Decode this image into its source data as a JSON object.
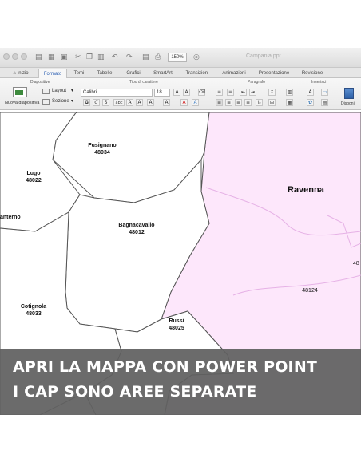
{
  "window": {
    "title": "Campania.ppt",
    "zoom": "150%"
  },
  "tabs": [
    "Inizio",
    "Formato",
    "Temi",
    "Tabelle",
    "Grafici",
    "SmartArt",
    "Transizioni",
    "Animazioni",
    "Presentazione",
    "Revisione"
  ],
  "active_tab": "Formato",
  "ribbon": {
    "groups": {
      "slides": "Diapositive",
      "font": "Tipo di carattere",
      "paragraph": "Paragrafo",
      "insert": "Inserisci"
    },
    "new_slide": "Nuova diapositiva",
    "layout": "Layout",
    "section": "Sezione",
    "font_name": "Calibri",
    "font_size": "18",
    "arrange": "Disponi"
  },
  "map": {
    "fill_colors": {
      "province_a": "#ffffff",
      "province_b": "#fde7fb"
    },
    "places": [
      {
        "name": "Fusignano",
        "cap": "48034"
      },
      {
        "name": "Lugo",
        "cap": "48022"
      },
      {
        "name": "Bagnacavallo",
        "cap": "48012"
      },
      {
        "name": "Cotignola",
        "cap": "48033"
      },
      {
        "name": "Russi",
        "cap": "48025"
      },
      {
        "name": "",
        "cap": "48124"
      }
    ],
    "city": "Ravenna",
    "partial_place": "anterno",
    "partial_number": "48"
  },
  "overlay": {
    "line1": "APRI LA MAPPA CON POWER POINT",
    "line2": "I CAP SONO AREE SEPARATE"
  }
}
